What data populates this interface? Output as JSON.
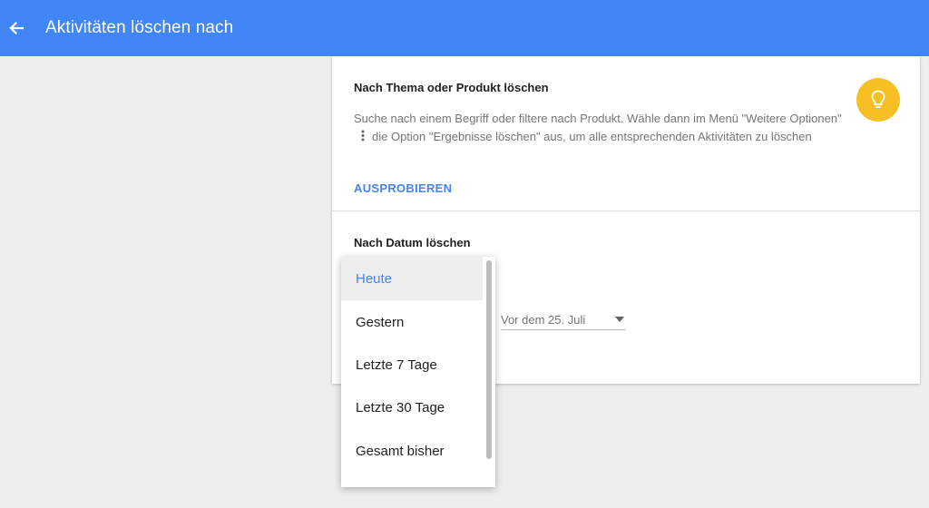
{
  "appbar": {
    "title": "Aktivitäten löschen nach",
    "back_icon": "arrow-back-icon",
    "color": "#4285f4"
  },
  "topic_section": {
    "title": "Nach Thema oder Produkt löschen",
    "description_before_icon": "Suche nach einem Begriff oder filtere nach Produkt. Wähle dann im Menü \"Weitere Optionen\"",
    "description_after_icon": "die Option \"Ergebnisse löschen\" aus, um alle entsprechenden Aktivitäten zu löschen",
    "inline_icon": "more-vert-icon",
    "link_label": "AUSPROBIEREN",
    "badge_icon": "lightbulb-icon",
    "badge_color": "#f6c025"
  },
  "date_section": {
    "title": "Nach Datum löschen",
    "date_value": "Vor dem 25. Juli"
  },
  "dropdown": {
    "items": [
      {
        "label": "Heute",
        "selected": true
      },
      {
        "label": "Gestern",
        "selected": false
      },
      {
        "label": "Letzte 7 Tage",
        "selected": false
      },
      {
        "label": "Letzte 30 Tage",
        "selected": false
      },
      {
        "label": "Gesamt bisher",
        "selected": false
      }
    ],
    "selected_color": "#4285f4"
  }
}
